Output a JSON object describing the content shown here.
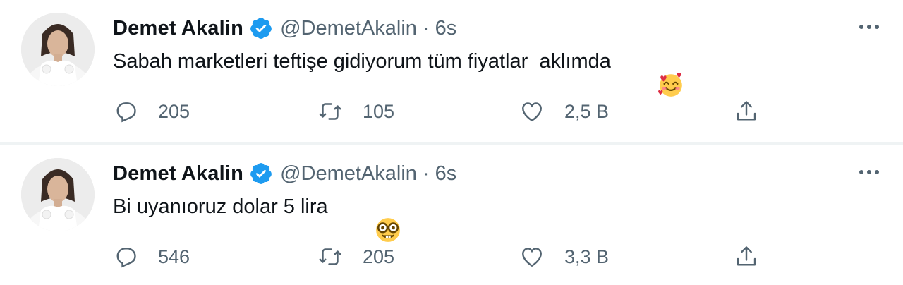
{
  "tweets": [
    {
      "author": {
        "name": "Demet Akalin",
        "handle": "@DemetAkalin",
        "verified_icon": "verified-badge-icon"
      },
      "separator": "·",
      "time": "6s",
      "text": "Sabah marketleri teftişe gidiyorum tüm fiyatlar  aklımda",
      "emoji": "smiling-face-with-hearts",
      "stats": {
        "replies": "205",
        "retweets": "105",
        "likes": "2,5 B"
      }
    },
    {
      "author": {
        "name": "Demet Akalin",
        "handle": "@DemetAkalin",
        "verified_icon": "verified-badge-icon"
      },
      "separator": "·",
      "time": "6s",
      "text": "Bi uyanıoruz dolar 5 lira",
      "emoji": "nerd-face",
      "stats": {
        "replies": "546",
        "retweets": "205",
        "likes": "3,3 B"
      }
    }
  ],
  "colors": {
    "text_primary": "#0f1419",
    "text_secondary": "#536471",
    "verified": "#1d9bf0",
    "divider": "#eff3f4"
  }
}
